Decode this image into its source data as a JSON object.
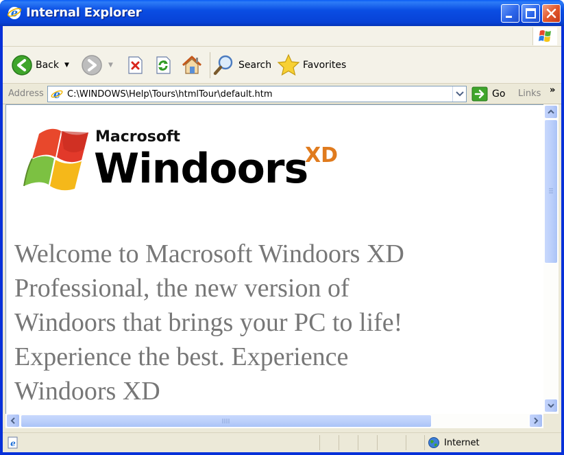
{
  "window": {
    "title": "Internal Explorer"
  },
  "toolbar": {
    "back_label": "Back",
    "search_label": "Search",
    "favorites_label": "Favorites"
  },
  "address": {
    "label": "Address",
    "url": "C:\\WINDOWS\\Help\\Tours\\htmlTour\\default.htm",
    "go_label": "Go",
    "links_label": "Links",
    "links_more": "»"
  },
  "content": {
    "brand_small": "Macrosoft",
    "brand_big": "Windoors",
    "brand_sup": "XD",
    "welcome": "Welcome to Macrosoft Windoors XD Professional, the new version of Windoors that brings your PC to life! Experience the best. Experience Windoors XD"
  },
  "status": {
    "zone_label": "Internet"
  },
  "colors": {
    "titlebar": "#0a4de3",
    "chrome": "#ece9d8",
    "brand_sup": "#e07b1e",
    "welcome_text": "#777777"
  }
}
